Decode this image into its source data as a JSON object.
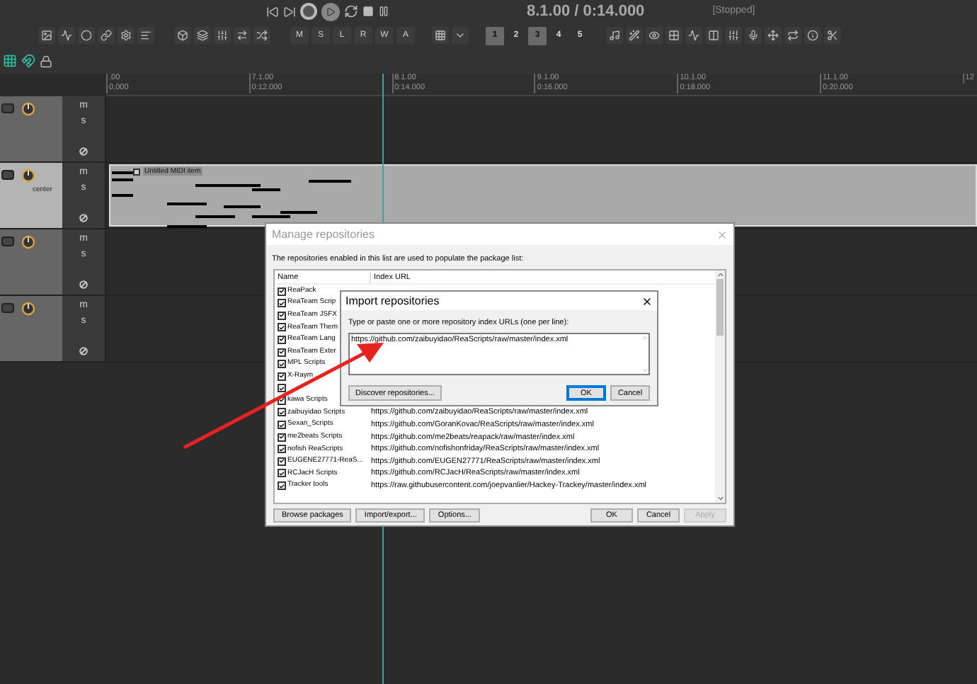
{
  "transport": {
    "time": "8.1.00 / 0:14.000",
    "status": "[Stopped]"
  },
  "toolbar": {
    "automation_buttons": [
      "M",
      "S",
      "L",
      "R",
      "W",
      "A"
    ],
    "screensets": [
      {
        "label": "1",
        "selected": true
      },
      {
        "label": "2",
        "selected": false
      },
      {
        "label": "3",
        "selected": true
      },
      {
        "label": "4",
        "selected": false
      },
      {
        "label": "5",
        "selected": false
      }
    ]
  },
  "ruler": {
    "marks": [
      {
        "bar": ".00",
        "time": "0.000"
      },
      {
        "bar": "7.1.00",
        "time": "0:12.000"
      },
      {
        "bar": "8.1.00",
        "time": "0:14.000"
      },
      {
        "bar": "9.1.00",
        "time": "0:16.000"
      },
      {
        "bar": "10.1.00",
        "time": "0:18.000"
      },
      {
        "bar": "11.1.00",
        "time": "0:20.000"
      },
      {
        "bar": "12"
      }
    ]
  },
  "tracks": [
    {
      "selected": false,
      "mute": "m",
      "solo": "s"
    },
    {
      "selected": true,
      "mute": "m",
      "solo": "s",
      "pan": "center"
    },
    {
      "selected": false,
      "mute": "m",
      "solo": "s"
    },
    {
      "selected": false,
      "mute": "m",
      "solo": "s"
    }
  ],
  "midi_item": {
    "title": "Untitled MIDI item"
  },
  "manage_dialog": {
    "title": "Manage repositories",
    "description": "The repositories enabled in this list are used to populate the package list:",
    "columns": [
      "Name",
      "Index URL"
    ],
    "rows": [
      {
        "name": "ReaPack",
        "checked": true
      },
      {
        "name": "ReaTeam Scrip",
        "checked": true
      },
      {
        "name": "ReaTeam JSFX",
        "checked": true
      },
      {
        "name": "ReaTeam Them",
        "checked": true
      },
      {
        "name": "ReaTeam Lang",
        "checked": true
      },
      {
        "name": "ReaTeam Exter",
        "checked": true
      },
      {
        "name": "MPL Scripts",
        "checked": true
      },
      {
        "name": "X-Raym",
        "checked": true
      },
      {
        "checked": true
      },
      {
        "name": "kawa Scripts",
        "checked": true
      },
      {
        "name": "zaibuyidao Scripts",
        "checked": true,
        "url": "https://github.com/zaibuyidao/ReaScripts/raw/master/index.xml"
      },
      {
        "name": "Sexan_Scripts",
        "checked": true,
        "url": "https://github.com/GoranKovac/ReaScripts/raw/master/index.xml"
      },
      {
        "name": "me2beats Scripts",
        "checked": true,
        "url": "https://github.com/me2beats/reapack/raw/master/index.xml"
      },
      {
        "name": "nofish ReaScripts",
        "checked": true,
        "url": "https://github.com/nofishonfriday/ReaScripts/raw/master/index.xml"
      },
      {
        "name": "EUGENE27771-ReaS...",
        "checked": true,
        "url": "https://github.com/EUGEN27771/ReaScripts/raw/master/index.xml"
      },
      {
        "name": "RCJacH Scripts",
        "checked": true,
        "url": "https://github.com/RCJacH/ReaScripts/raw/master/index.xml"
      },
      {
        "name": "Tracker tools",
        "checked": true,
        "url": "https://raw.githubusercontent.com/joepvanlier/Hackey-Trackey/master/index.xml"
      }
    ],
    "left_buttons": [
      {
        "label": "Browse packages",
        "disabled": false
      },
      {
        "label": "Import/export...",
        "disabled": false
      },
      {
        "label": "Options...",
        "disabled": false
      }
    ],
    "right_buttons": [
      {
        "label": "OK",
        "disabled": false
      },
      {
        "label": "Cancel",
        "disabled": false
      },
      {
        "label": "Apply",
        "disabled": true
      }
    ]
  },
  "import_dialog": {
    "title": "Import repositories",
    "prompt": "Type or paste one or more repository index URLs (one per line):",
    "value": "https://github.com/zaibuyidao/ReaScripts/raw/master/index.xml",
    "buttons": [
      {
        "label": "Discover repositories...",
        "kind": "secondary"
      },
      {
        "label": "OK",
        "kind": "default"
      },
      {
        "label": "Cancel",
        "kind": "normal"
      }
    ]
  }
}
